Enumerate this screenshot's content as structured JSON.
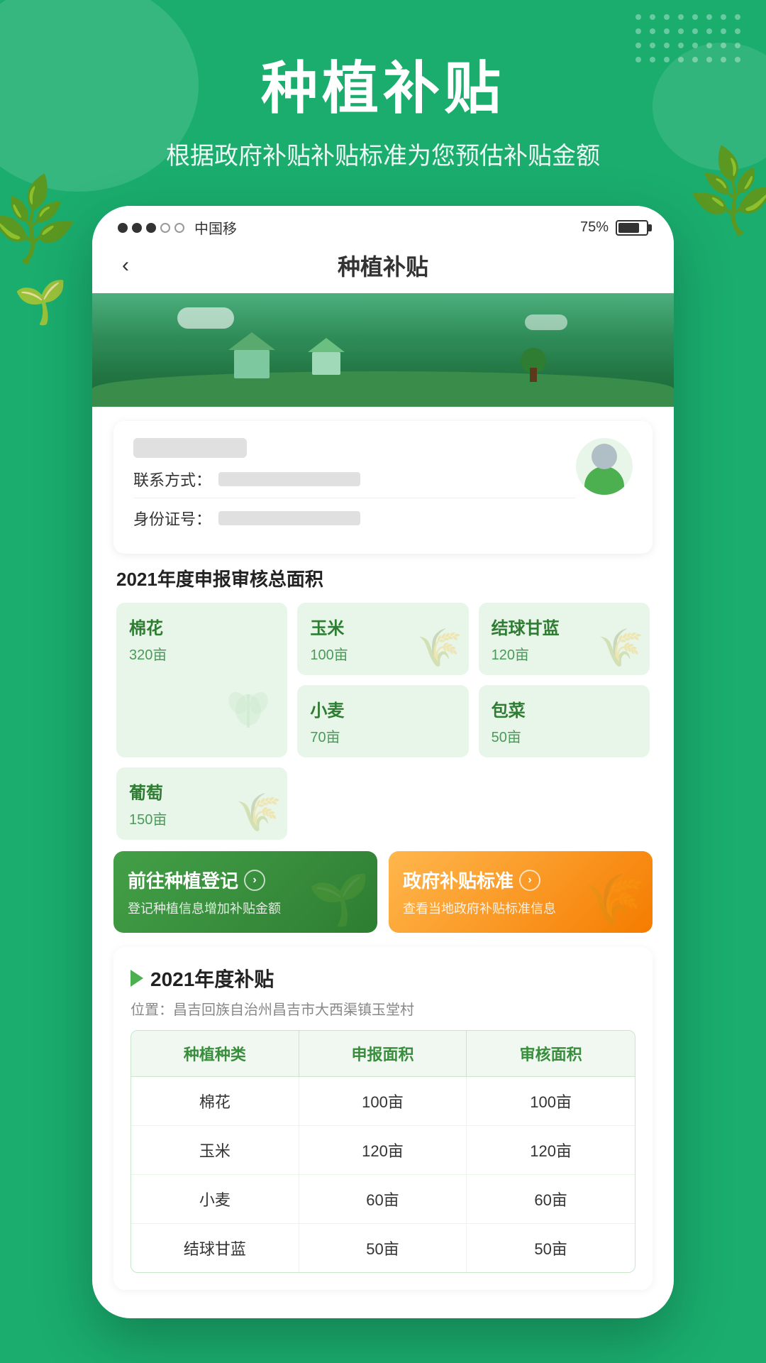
{
  "app": {
    "title": "种植补贴",
    "subtitle": "根据政府补贴补贴标准为您预估补贴金额"
  },
  "statusBar": {
    "carrier": "中国移",
    "battery": "75%",
    "dots": [
      "filled",
      "filled",
      "filled",
      "empty",
      "empty"
    ]
  },
  "nav": {
    "backLabel": "‹",
    "title": "种植补贴"
  },
  "userCard": {
    "contactLabel": "联系方式：",
    "idLabel": "身份证号："
  },
  "areaSection": {
    "title": "2021年度申报审核总面积",
    "crops": [
      {
        "name": "棉花",
        "area": "320亩",
        "large": true
      },
      {
        "name": "玉米",
        "area": "100亩",
        "large": false
      },
      {
        "name": "结球甘蓝",
        "area": "120亩",
        "large": false
      },
      {
        "name": "小麦",
        "area": "70亩",
        "large": false
      },
      {
        "name": "包菜",
        "area": "50亩",
        "large": false
      },
      {
        "name": "葡萄",
        "area": "150亩",
        "large": false
      }
    ]
  },
  "actionButtons": {
    "register": {
      "title": "前往种植登记",
      "desc": "登记种植信息增加补贴金额",
      "arrow": "›"
    },
    "standard": {
      "title": "政府补贴标准",
      "desc": "查看当地政府补贴标准信息",
      "arrow": "›"
    }
  },
  "subsidySection": {
    "title": "2021年度补贴",
    "location": "位置：昌吉回族自治州昌吉市大西渠镇玉堂村",
    "tableHeaders": [
      "种植种类",
      "申报面积",
      "审核面积"
    ],
    "tableRows": [
      {
        "crop": "棉花",
        "reported": "100亩",
        "approved": "100亩"
      },
      {
        "crop": "玉米",
        "reported": "120亩",
        "approved": "120亩"
      },
      {
        "crop": "小麦",
        "reported": "60亩",
        "approved": "60亩"
      },
      {
        "crop": "结球甘蓝",
        "reported": "50亩",
        "approved": "50亩"
      }
    ]
  }
}
